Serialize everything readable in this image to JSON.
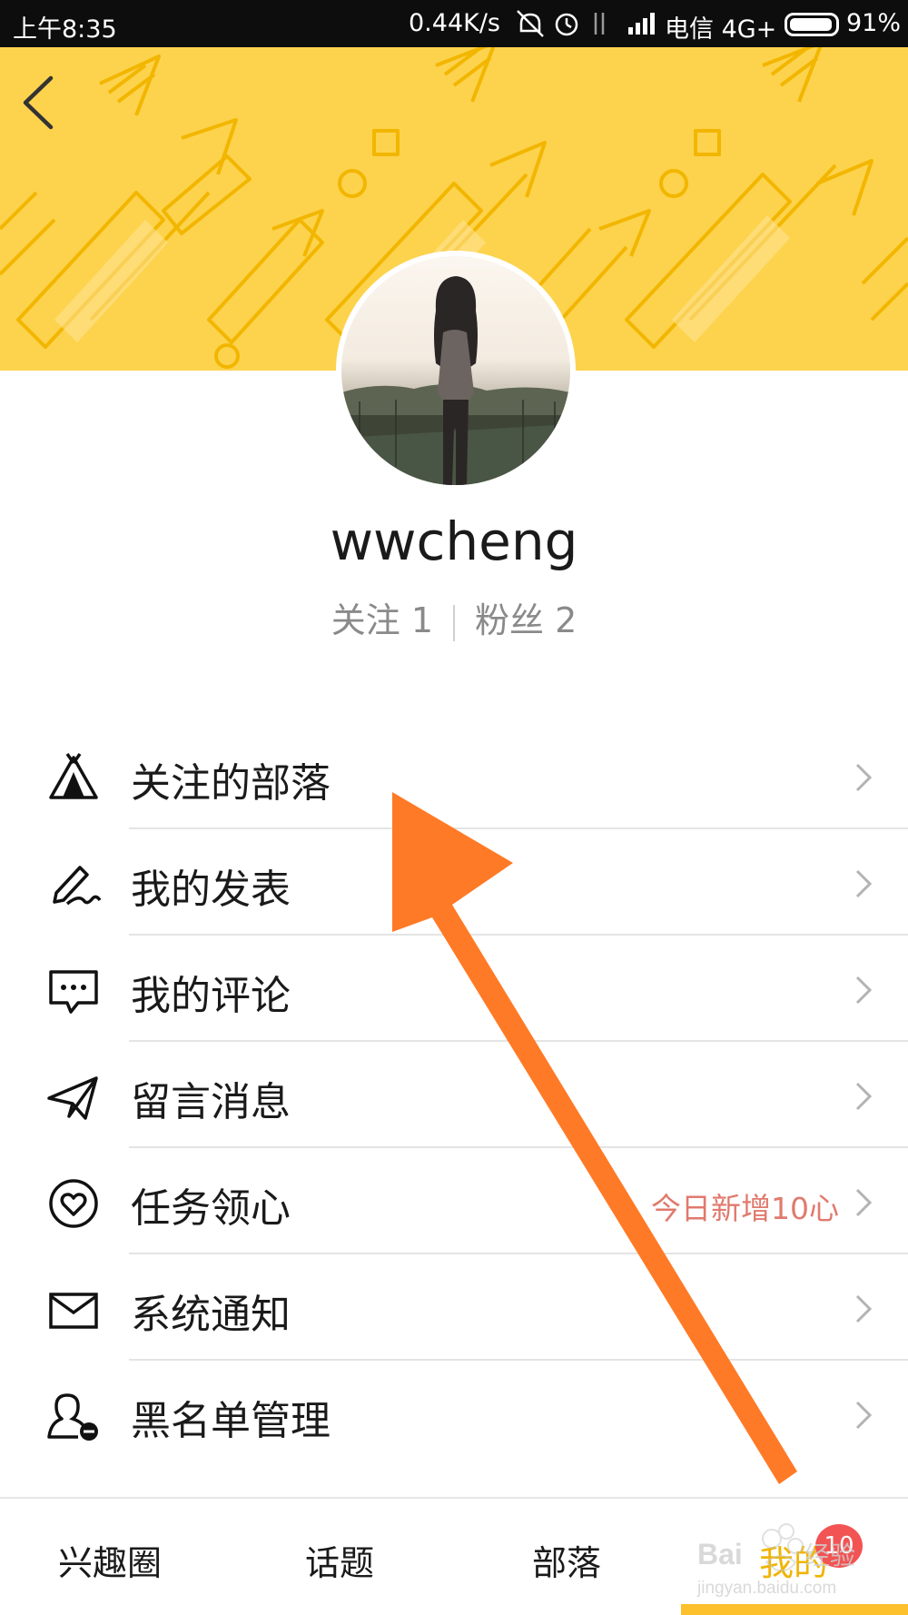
{
  "status_bar": {
    "time": "上午8:35",
    "net_speed": "0.44K/s",
    "carrier": "电信 4G+",
    "battery": "91%"
  },
  "profile": {
    "username": "wwcheng",
    "following_label": "关注 1",
    "followers_label": "粉丝 2"
  },
  "menu": [
    {
      "label": "关注的部落",
      "icon": "tent-icon",
      "extra": ""
    },
    {
      "label": "我的发表",
      "icon": "pen-icon",
      "extra": ""
    },
    {
      "label": "我的评论",
      "icon": "comment-icon",
      "extra": ""
    },
    {
      "label": "留言消息",
      "icon": "paper-plane-icon",
      "extra": ""
    },
    {
      "label": "任务领心",
      "icon": "heart-icon",
      "extra": "今日新增10心"
    },
    {
      "label": "系统通知",
      "icon": "envelope-icon",
      "extra": ""
    },
    {
      "label": "黑名单管理",
      "icon": "user-block-icon",
      "extra": ""
    }
  ],
  "bottom_nav": {
    "items": [
      "兴趣圈",
      "话题",
      "部落",
      "我的"
    ],
    "badge": "10"
  },
  "watermark": {
    "text": "Bai 经验",
    "url": "jingyan.baidu.com"
  },
  "colors": {
    "banner": "#fdd34d",
    "banner_pattern": "#f5b800",
    "accent_orange": "#ff7a26",
    "highlight_red": "#e07a6e",
    "badge_red": "#f25353",
    "nav_indicator": "#fdc12d"
  }
}
